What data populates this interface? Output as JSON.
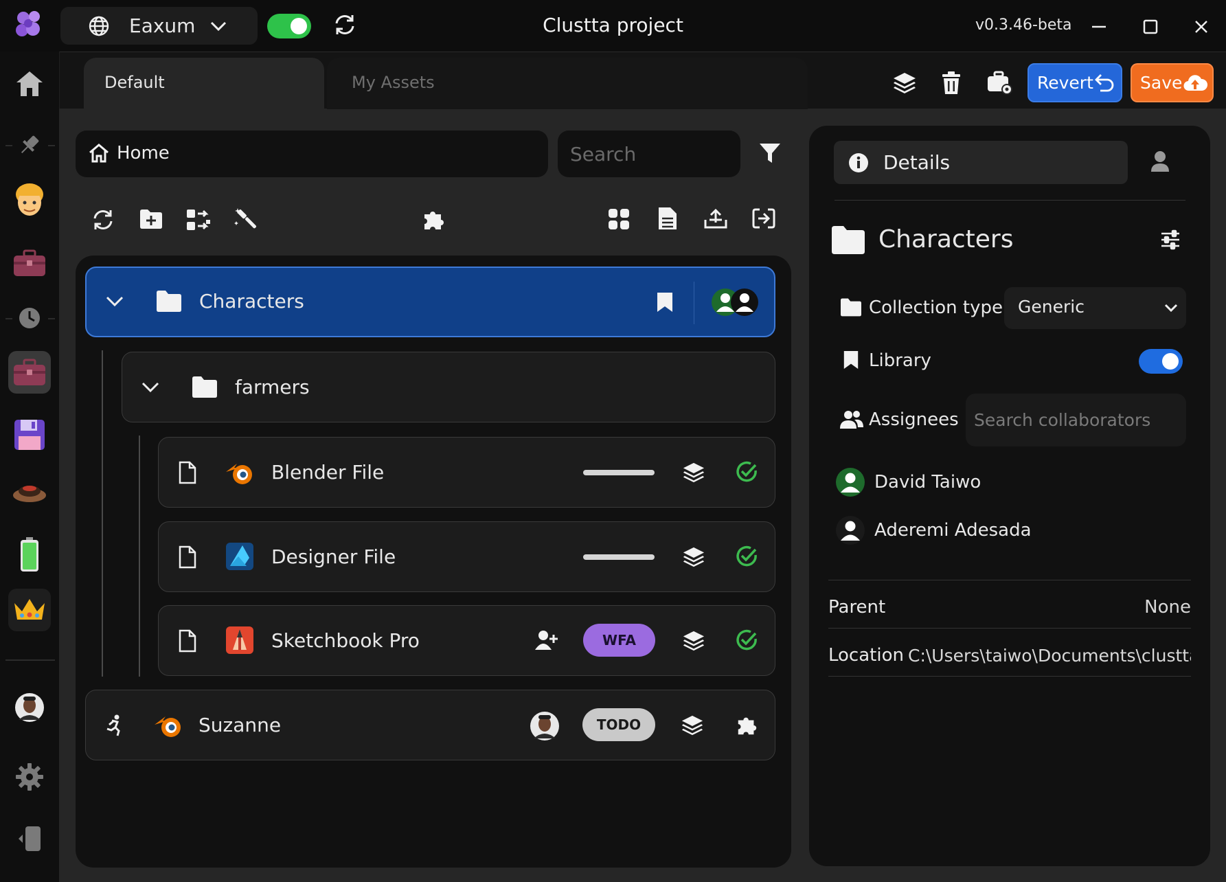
{
  "window": {
    "title": "Clustta project",
    "version": "v0.3.46-beta",
    "workspace": "Eaxum"
  },
  "tabs": [
    {
      "label": "Default",
      "active": true
    },
    {
      "label": "My Assets",
      "active": false
    }
  ],
  "toolbar": {
    "revert_label": "Revert",
    "save_label": "Save"
  },
  "browser": {
    "breadcrumb": "Home",
    "search_placeholder": "Search"
  },
  "tree": {
    "root": {
      "name": "Characters",
      "expanded": true,
      "selected": true
    },
    "folder": {
      "name": "farmers",
      "expanded": true
    },
    "files": [
      {
        "name": "Blender File",
        "app": "blender",
        "status": "done"
      },
      {
        "name": "Designer File",
        "app": "affinity-designer",
        "status": "done"
      },
      {
        "name": "Sketchbook Pro",
        "app": "sketchbook",
        "badge": "WFA",
        "badge_color": "#9b6be0",
        "status": "done"
      }
    ],
    "asset": {
      "name": "Suzanne",
      "app": "blender",
      "badge": "TODO",
      "badge_color": "#c9c9c9"
    }
  },
  "details": {
    "header": "Details",
    "collection_name": "Characters",
    "collection_type_label": "Collection type",
    "collection_type_value": "Generic",
    "library_label": "Library",
    "library_on": true,
    "assignees_label": "Assignees",
    "collaborator_placeholder": "Search collaborators",
    "assignees": [
      "David Taiwo",
      "Aderemi Adesada"
    ],
    "parent_label": "Parent",
    "parent_value": "None",
    "location_label": "Location",
    "location_value": "C:\\Users\\taiwo\\Documents\\clustta\\fo"
  },
  "colors": {
    "accent_blue": "#2467d9",
    "save_orange": "#f06c1f",
    "selected_row": "#104089",
    "success_green": "#3dbb4f"
  }
}
